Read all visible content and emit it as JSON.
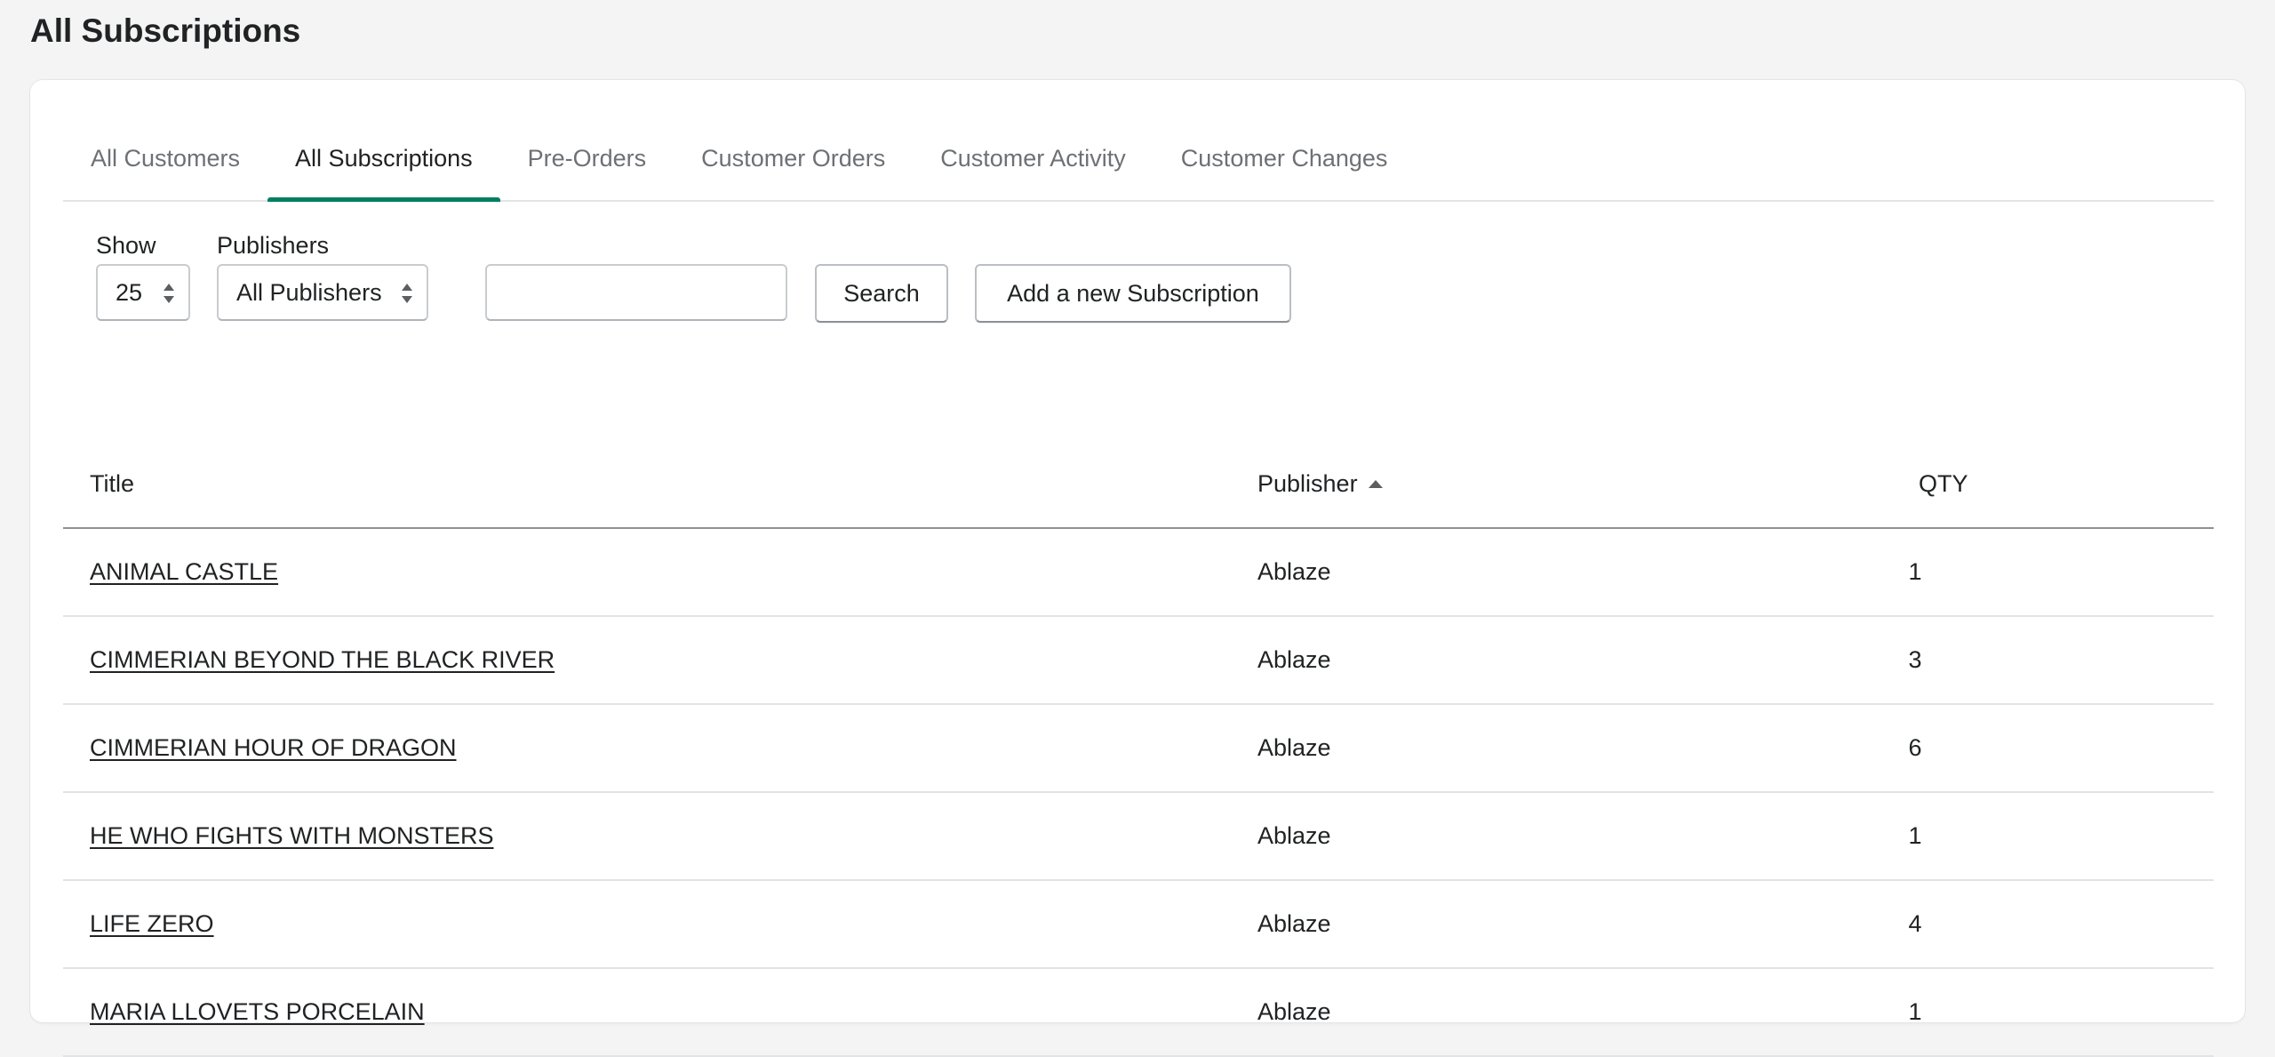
{
  "page": {
    "title": "All Subscriptions"
  },
  "tabs": [
    {
      "label": "All Customers",
      "active": false
    },
    {
      "label": "All Subscriptions",
      "active": true
    },
    {
      "label": "Pre-Orders",
      "active": false
    },
    {
      "label": "Customer Orders",
      "active": false
    },
    {
      "label": "Customer Activity",
      "active": false
    },
    {
      "label": "Customer Changes",
      "active": false
    }
  ],
  "filters": {
    "show_label": "Show",
    "show_value": "25",
    "publishers_label": "Publishers",
    "publishers_value": "All Publishers",
    "search_value": "",
    "search_button": "Search",
    "add_button": "Add a new Subscription"
  },
  "table": {
    "headers": {
      "title": "Title",
      "publisher": "Publisher",
      "qty": "QTY"
    },
    "sort": {
      "column": "publisher",
      "direction": "ascending"
    },
    "rows": [
      {
        "title": "ANIMAL CASTLE",
        "publisher": "Ablaze",
        "qty": "1"
      },
      {
        "title": "CIMMERIAN BEYOND THE BLACK RIVER",
        "publisher": "Ablaze",
        "qty": "3"
      },
      {
        "title": "CIMMERIAN HOUR OF DRAGON",
        "publisher": "Ablaze",
        "qty": "6"
      },
      {
        "title": "HE WHO FIGHTS WITH MONSTERS",
        "publisher": "Ablaze",
        "qty": "1"
      },
      {
        "title": "LIFE ZERO",
        "publisher": "Ablaze",
        "qty": "4"
      },
      {
        "title": "MARIA LLOVETS PORCELAIN",
        "publisher": "Ablaze",
        "qty": "1"
      }
    ]
  },
  "colors": {
    "accent": "#008060",
    "background": "#f4f4f4",
    "text": "#202223",
    "muted_text": "#6d7175"
  }
}
